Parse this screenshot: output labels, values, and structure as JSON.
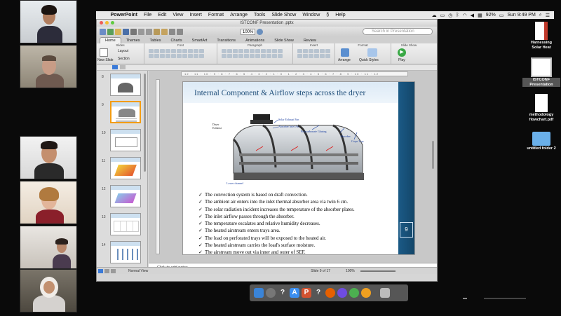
{
  "menubar": {
    "app_name": "PowerPoint",
    "items": [
      "File",
      "Edit",
      "View",
      "Insert",
      "Format",
      "Arrange",
      "Tools",
      "Slide Show",
      "Window"
    ],
    "help": "Help",
    "battery": "92%",
    "clock": "Sun 9:49 PM"
  },
  "window": {
    "title": "ISTCONF Presentation .pptx",
    "zoom": "100%",
    "search_placeholder": "Search in Presentation"
  },
  "ribbon": {
    "tabs": [
      "Home",
      "Themes",
      "Tables",
      "Charts",
      "SmartArt",
      "Transitions",
      "Animations",
      "Slide Show",
      "Review"
    ],
    "groups": {
      "slides": "Slides",
      "font": "Font",
      "paragraph": "Paragraph",
      "insert": "Insert",
      "format": "Format",
      "slide_show": "Slide Show"
    },
    "buttons": {
      "new_slide": "New Slide",
      "layout": "Layout",
      "section": "Section",
      "arrange": "Arrange",
      "quick_styles": "Quick Styles",
      "play": "Play"
    }
  },
  "thumbnails": [
    {
      "num": "8"
    },
    {
      "num": "9"
    },
    {
      "num": "10"
    },
    {
      "num": "11"
    },
    {
      "num": "12"
    },
    {
      "num": "13"
    },
    {
      "num": "14"
    }
  ],
  "ruler_text": "12 · 11 · 10 · 9 · 8 · 7 · 6 · 5 · 4 · 3 · 2 · 1 · 0 · 1 · 2 · 3 · 4 · 5 · 6 · 7 · 8 · 9 · 10 · 11 · 12",
  "slide": {
    "title": "Internal Component & Airflow steps across the dryer",
    "page_number": "9",
    "diagram_labels": {
      "solar_exhaust_fan": "Solar Exhaust Fan",
      "dryer_exhaust": "Dryer\nExhaust",
      "absorber_inlet_air": "Absorber Inlet Air",
      "polycarbonate": "Polycarbonate Glazing",
      "absorber": "Absorber",
      "crops_tray": "Crops Tray",
      "lower_channel": "Lower channel"
    },
    "bullets": [
      "The convection system is based on draft convection.",
      "The ambient air enters into the inlet thermal absorber area via twin 6 cm.",
      "The solar radiation incident increases the temperature of the absorber plates.",
      "The inlet airflow passes through the absorber.",
      "The temperature escalates and relative humidity decreases.",
      "The heated airstream enters trays area.",
      "The load on perforated trays will be exposed to the heated air.",
      "The heated airstream carries the load's surface moisture.",
      "The airstream move out via inner and outer of SEF."
    ]
  },
  "notes_placeholder": "Click to add notes",
  "status": {
    "view": "Normal View",
    "slide_of": "Slide 9 of 17",
    "zoom": "100%"
  },
  "desktop_icons": [
    {
      "label": "Harnessing\nSolar Heat"
    },
    {
      "label": "ISTCONF\nPresentation"
    },
    {
      "label": "methodology\nflowchart.pdf"
    },
    {
      "label": "untitled folder 2"
    }
  ],
  "colors": {
    "slide_title": "#1f4e79",
    "slide_rightbar": "#1b5a86",
    "selected_thumb": "#f39c12",
    "accent_blue": "#3a7ad8"
  }
}
